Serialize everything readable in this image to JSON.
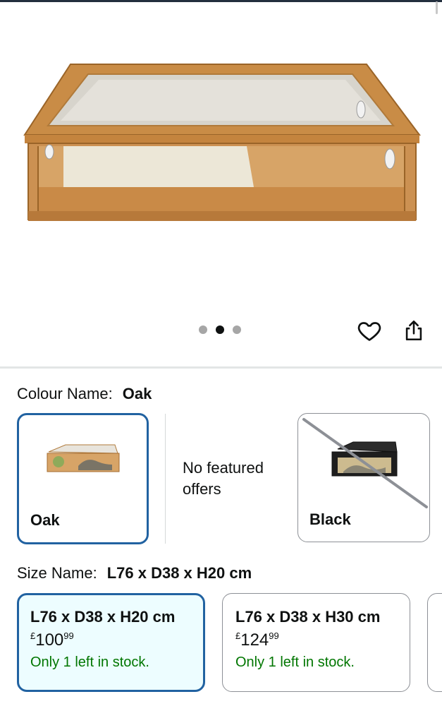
{
  "gallery": {
    "image_alt": "Oak wooden vivarium with glass top and front",
    "dots": [
      {
        "active": false
      },
      {
        "active": true
      },
      {
        "active": false
      }
    ],
    "heart_icon": "heart-icon",
    "share_icon": "share-icon"
  },
  "colour": {
    "label": "Colour Name:",
    "selected_value": "Oak",
    "options": [
      {
        "name": "Oak",
        "selected": true,
        "available": true
      },
      {
        "name": "Black",
        "selected": false,
        "available": false
      }
    ],
    "no_offers_text": "No featured offers"
  },
  "size": {
    "label": "Size Name:",
    "selected_value": "L76 x D38 x H20 cm",
    "options": [
      {
        "title": "L76 x D38 x H20 cm",
        "currency": "£",
        "price_whole": "100",
        "price_fraction": "99",
        "stock": "Only 1 left in stock.",
        "selected": true
      },
      {
        "title": "L76 x D38 x H30 cm",
        "currency": "£",
        "price_whole": "124",
        "price_fraction": "99",
        "stock": "Only 1 left in stock.",
        "selected": false
      }
    ]
  },
  "colors": {
    "selected_border": "#2162a1",
    "stock_green": "#007600",
    "selected_bg": "#edfdff"
  }
}
